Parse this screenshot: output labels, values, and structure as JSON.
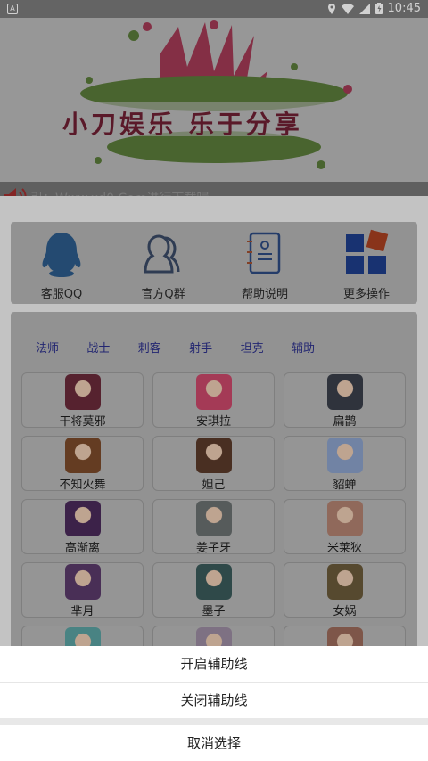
{
  "status_bar": {
    "app_indicator": "A",
    "time": "10:45"
  },
  "banner": {
    "title": "小刀娱乐 乐于分享",
    "marquee": "引：Www.xd0.Com进行下载喔"
  },
  "actions": [
    {
      "label": "客服QQ",
      "icon": "qq-penguin-icon"
    },
    {
      "label": "官方Q群",
      "icon": "qq-group-icon"
    },
    {
      "label": "帮助说明",
      "icon": "help-notebook-icon"
    },
    {
      "label": "更多操作",
      "icon": "more-apps-icon"
    }
  ],
  "tabs": [
    "法师",
    "战士",
    "刺客",
    "射手",
    "坦克",
    "辅助"
  ],
  "heroes": [
    {
      "name": "干将莫邪",
      "color": "#6a2a3a"
    },
    {
      "name": "安琪拉",
      "color": "#c8476a"
    },
    {
      "name": "扁鹊",
      "color": "#3a3f4a"
    },
    {
      "name": "不知火舞",
      "color": "#7a4a2a"
    },
    {
      "name": "妲己",
      "color": "#5a3a2a"
    },
    {
      "name": "貂蝉",
      "color": "#8aa0c8"
    },
    {
      "name": "高渐离",
      "color": "#4a2a5a"
    },
    {
      "name": "姜子牙",
      "color": "#6a7070"
    },
    {
      "name": "米莱狄",
      "color": "#b08070"
    },
    {
      "name": "芈月",
      "color": "#5a3a6a"
    },
    {
      "name": "墨子",
      "color": "#3a5a5a"
    },
    {
      "name": "女娲",
      "color": "#6a5a3a"
    },
    {
      "name": "",
      "color": "#5aa0a0"
    },
    {
      "name": "",
      "color": "#9a8aa0"
    },
    {
      "name": "",
      "color": "#9a6a5a"
    }
  ],
  "sheet": {
    "open_label": "开启辅助线",
    "close_label": "关闭辅助线",
    "cancel_label": "取消选择"
  }
}
